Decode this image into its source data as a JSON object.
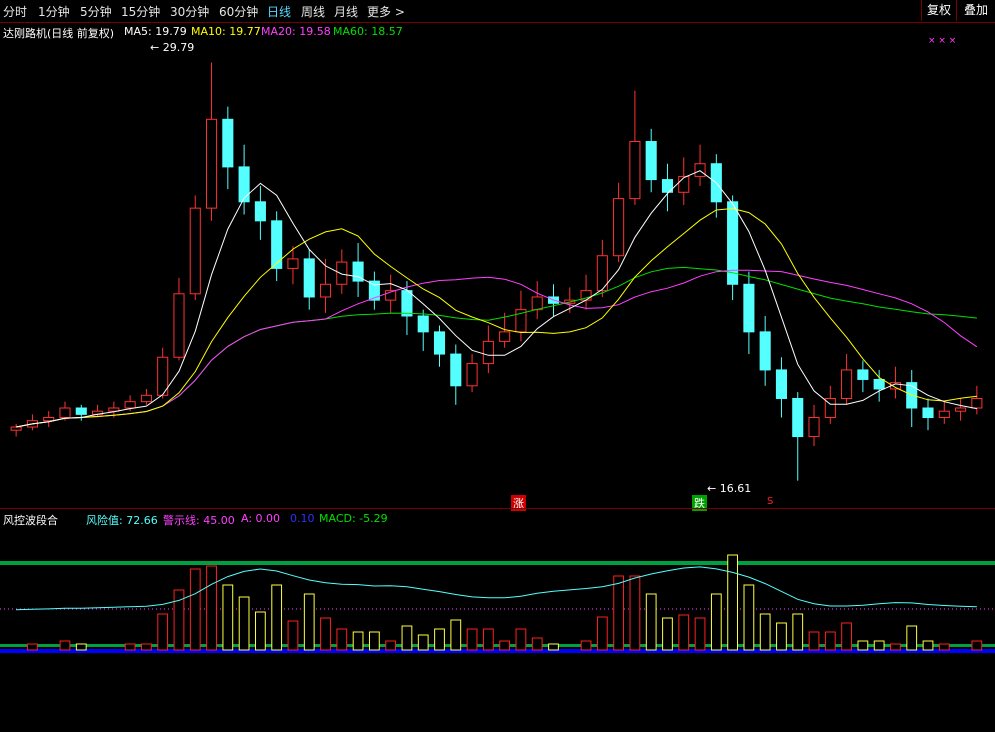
{
  "toolbar": {
    "periods": [
      "分时",
      "1分钟",
      "5分钟",
      "15分钟",
      "30分钟",
      "60分钟",
      "日线",
      "周线",
      "月线",
      "更多 >"
    ],
    "active_period": "日线",
    "fuquan_label": "复权",
    "diejia_label": "叠加"
  },
  "main_chart": {
    "title": "达刚路机(日线 前复权)",
    "ma5": "MA5: 19.79",
    "ma10": "MA10: 19.77",
    "ma20": "MA20: 19.58",
    "ma60": "MA60: 18.57",
    "high_label": "29.79",
    "low_label": "16.61",
    "zhang_label": "涨",
    "die_label": "跌",
    "s_label": "S",
    "x_markers": "×  ×  ×"
  },
  "indicator": {
    "name": "风控波段合",
    "risk": "风险值: 72.66",
    "warn": "警示线: 45.00",
    "a": "A: 0.00",
    "b": "0.10",
    "macd": "MACD: -5.29"
  },
  "colors": {
    "up": "#ff3232",
    "down": "#54ffff",
    "ma5": "#ffffff",
    "ma10": "#ffff00",
    "ma20": "#ff40ff",
    "ma60": "#00e000",
    "risk_line": "#54ffff",
    "green_band": "#00a040",
    "blue_band": "#0000ff"
  },
  "chart_data": {
    "type": "candlestick",
    "security": "达刚路机",
    "price_range": [
      16.0,
      30.5
    ],
    "highest": 29.79,
    "lowest": 16.61,
    "candles_approx": [
      [
        18.2,
        18.3,
        18.0,
        18.4
      ],
      [
        18.3,
        18.5,
        18.2,
        18.7
      ],
      [
        18.5,
        18.6,
        18.3,
        18.8
      ],
      [
        18.6,
        18.9,
        18.5,
        19.1
      ],
      [
        18.9,
        18.7,
        18.5,
        19.0
      ],
      [
        18.7,
        18.8,
        18.6,
        19.0
      ],
      [
        18.8,
        18.9,
        18.6,
        19.1
      ],
      [
        18.9,
        19.1,
        18.8,
        19.3
      ],
      [
        19.1,
        19.3,
        19.0,
        19.5
      ],
      [
        19.3,
        20.5,
        19.2,
        20.8
      ],
      [
        20.5,
        22.5,
        20.4,
        23.0
      ],
      [
        22.5,
        25.2,
        22.3,
        25.6
      ],
      [
        25.2,
        28.0,
        24.8,
        29.79
      ],
      [
        28.0,
        26.5,
        25.8,
        28.4
      ],
      [
        26.5,
        25.4,
        25.0,
        27.2
      ],
      [
        25.4,
        24.8,
        24.2,
        25.9
      ],
      [
        24.8,
        23.3,
        22.9,
        25.1
      ],
      [
        23.3,
        23.6,
        22.8,
        24.0
      ],
      [
        23.6,
        22.4,
        22.0,
        23.9
      ],
      [
        22.4,
        22.8,
        21.9,
        23.6
      ],
      [
        22.8,
        23.5,
        22.5,
        23.9
      ],
      [
        23.5,
        22.9,
        22.4,
        24.1
      ],
      [
        22.9,
        22.3,
        22.0,
        23.2
      ],
      [
        22.3,
        22.6,
        21.9,
        23.1
      ],
      [
        22.6,
        21.8,
        21.2,
        22.9
      ],
      [
        21.8,
        21.3,
        20.7,
        22.0
      ],
      [
        21.3,
        20.6,
        20.2,
        21.5
      ],
      [
        20.6,
        19.6,
        19.0,
        20.9
      ],
      [
        19.6,
        20.3,
        19.4,
        20.6
      ],
      [
        20.3,
        21.0,
        20.0,
        21.5
      ],
      [
        21.0,
        21.3,
        20.8,
        21.9
      ],
      [
        21.3,
        22.0,
        21.0,
        22.6
      ],
      [
        22.0,
        22.4,
        21.7,
        22.9
      ],
      [
        22.4,
        22.2,
        21.8,
        22.8
      ],
      [
        22.2,
        22.3,
        21.9,
        22.7
      ],
      [
        22.3,
        22.6,
        22.0,
        23.1
      ],
      [
        22.6,
        23.7,
        22.4,
        24.2
      ],
      [
        23.7,
        25.5,
        23.5,
        26.0
      ],
      [
        25.5,
        27.3,
        25.3,
        28.9
      ],
      [
        27.3,
        26.1,
        25.7,
        27.7
      ],
      [
        26.1,
        25.7,
        25.1,
        26.6
      ],
      [
        25.7,
        26.2,
        25.3,
        26.8
      ],
      [
        26.2,
        26.6,
        25.9,
        27.2
      ],
      [
        26.6,
        25.4,
        24.9,
        26.9
      ],
      [
        25.4,
        22.8,
        22.3,
        25.6
      ],
      [
        22.8,
        21.3,
        20.6,
        23.2
      ],
      [
        21.3,
        20.1,
        19.6,
        21.8
      ],
      [
        20.1,
        19.2,
        18.6,
        20.5
      ],
      [
        19.2,
        18.0,
        16.61,
        19.4
      ],
      [
        18.0,
        18.6,
        17.7,
        19.0
      ],
      [
        18.6,
        19.2,
        18.4,
        19.6
      ],
      [
        19.2,
        20.1,
        19.0,
        20.6
      ],
      [
        20.1,
        19.8,
        19.4,
        20.4
      ],
      [
        19.8,
        19.5,
        19.1,
        20.1
      ],
      [
        19.5,
        19.7,
        19.2,
        20.2
      ],
      [
        19.7,
        18.9,
        18.3,
        20.1
      ],
      [
        18.9,
        18.6,
        18.2,
        19.2
      ],
      [
        18.6,
        18.8,
        18.4,
        19.1
      ],
      [
        18.8,
        18.9,
        18.5,
        19.2
      ],
      [
        18.9,
        19.2,
        18.7,
        19.6
      ]
    ]
  }
}
